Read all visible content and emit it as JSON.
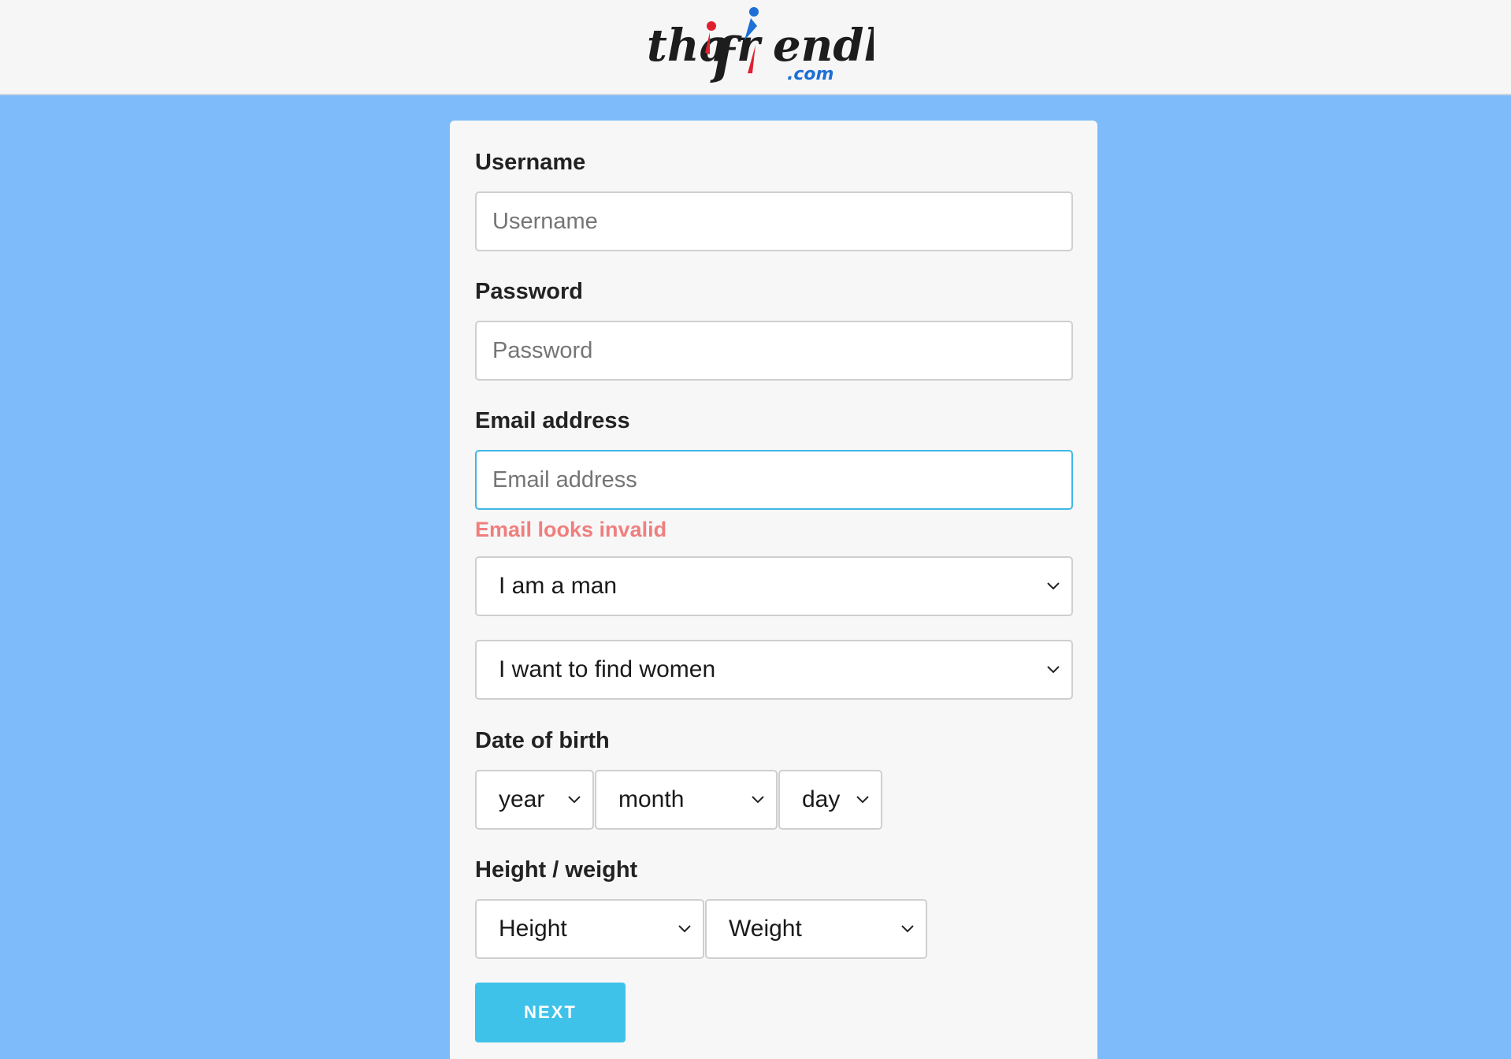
{
  "brand": {
    "logo_text": "thaifriendly",
    "logo_suffix": ".com",
    "colors": {
      "dark": "#1d1d1d",
      "red": "#e0202f",
      "blue": "#1e6fd6"
    }
  },
  "form": {
    "username": {
      "label": "Username",
      "placeholder": "Username"
    },
    "password": {
      "label": "Password",
      "placeholder": "Password"
    },
    "email": {
      "label": "Email address",
      "placeholder": "Email address",
      "error": "Email looks invalid"
    },
    "gender": {
      "value": "I am a man"
    },
    "seeking": {
      "value": "I want to find women"
    },
    "dob": {
      "label": "Date of birth",
      "year": "year",
      "month": "month",
      "day": "day"
    },
    "body": {
      "label": "Height / weight",
      "height": "Height",
      "weight": "Weight"
    },
    "next_label": "NEXT"
  },
  "colors": {
    "page_bg": "#7dbbfa",
    "card_bg": "#f7f7f7",
    "focus_border": "#3fb6e8",
    "error_text": "#f07e7e",
    "button_bg": "#3fc2ea"
  },
  "icons": {
    "select_chevron": "chevron-down-icon"
  }
}
